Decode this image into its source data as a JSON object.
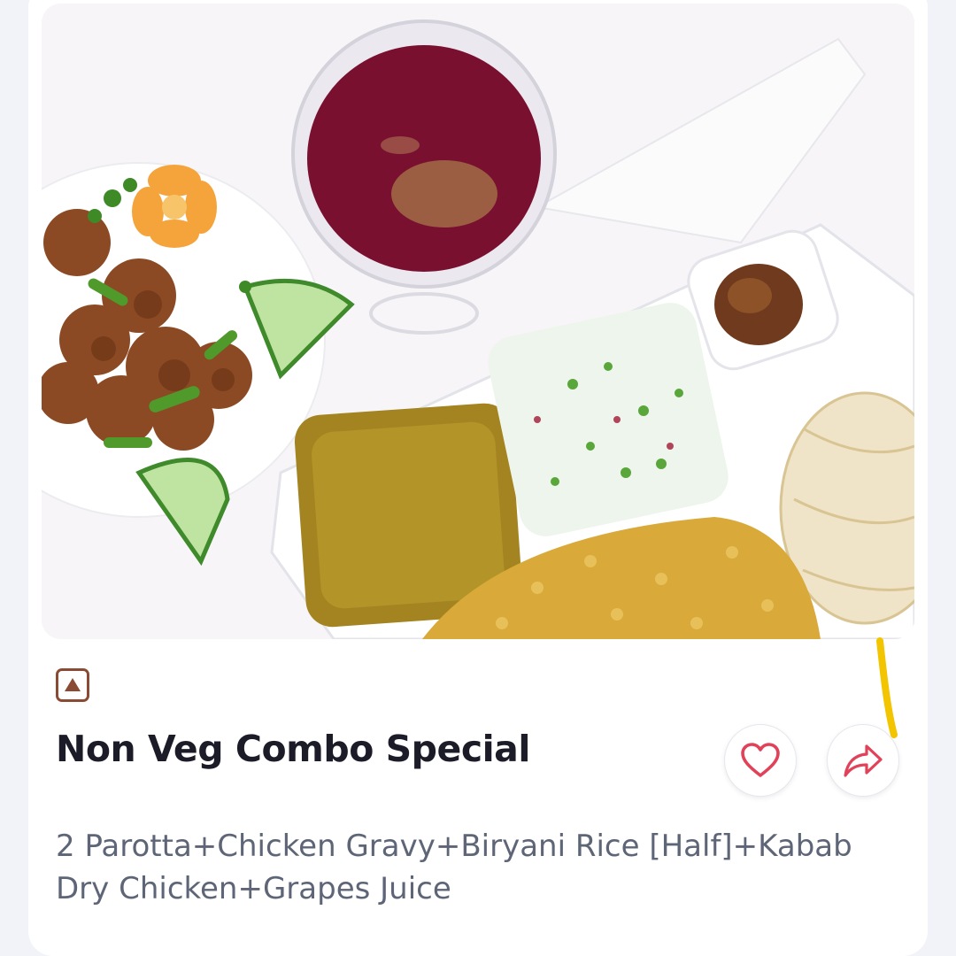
{
  "item": {
    "name": "Non Veg Combo Special",
    "description": "2 Parotta+Chicken Gravy+Biryani Rice [Half]+Kabab Dry Chicken+Grapes Juice",
    "food_type_icon": "non-veg-triangle-icon"
  },
  "actions": {
    "favorite_icon": "heart-icon",
    "share_icon": "share-arrow-icon"
  },
  "colors": {
    "non_veg_mark": "#8a4b35",
    "heart": "#e2415a",
    "title": "#1c1c28",
    "description": "#5d6577",
    "highlight_stroke": "#f2c500"
  }
}
